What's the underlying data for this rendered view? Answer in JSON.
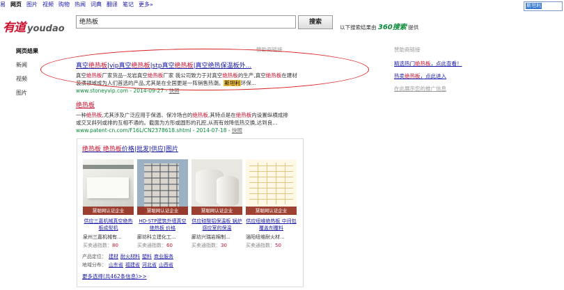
{
  "topnav": [
    "易",
    "网页",
    "图片",
    "视频",
    "购物",
    "热闻",
    "词典",
    "翻译",
    "笔记",
    "更多»"
  ],
  "topnav_active": 1,
  "top_right_input": "斯坦利",
  "logo": {
    "cn": "有道",
    "en": "youdao"
  },
  "search": {
    "value": "绝热板",
    "button": "搜索",
    "also_text": "以下搜索结果由",
    "brand": "360搜索",
    "provider": "提供"
  },
  "leftnav": [
    "网页结果",
    "新闻",
    "视频",
    "图片"
  ],
  "sponsor_label": "赞助商链接",
  "result1": {
    "title": [
      "真空",
      "绝热板",
      "|vip真空",
      "绝热板",
      "|stp真空",
      "绝热板",
      "|真空绝热保温板外..."
    ],
    "snippet1": [
      "真空",
      "绝热板",
      "厂家货品--龙岩真空",
      "绝热板",
      "厂家 我公司致力于对真空",
      "绝热板",
      "的生产,真空",
      "绝热板",
      "在建材"
    ],
    "snippet2_a": "装潢领域成为人们首选的产品,尤其是在全国更是一阵销售热潮。",
    "snippet2_hl": "斯坦利",
    "snippet2_b": "环保...",
    "url": "www.stoneyvip.com - 2014-09-27 - ",
    "snapshot": "快照"
  },
  "result2": {
    "title": "绝热板",
    "snippet1": [
      "一种",
      "绝热板",
      ",尤其涉及广泛应用于保温、保冷场合的",
      "绝热板",
      ",其特点是在",
      "绝热板",
      "内设置纵横成排"
    ],
    "snippet2": "或交叉斜列或排的互相不通的。截面为方形或圆形的孔腔,从而有效降低热交换,达到良...",
    "url": "www.patent-cn.com/F16L/CN2378618.shtml - 2014-07-18 - ",
    "snapshot": "快照"
  },
  "card": {
    "title": [
      "绝热板",
      " ",
      "绝热板",
      "价格|批发|供应|图片"
    ],
    "badge": "慧聪网认证企业",
    "index_label": "买卖通指数：",
    "products": [
      {
        "title": "供应三嘉机械真空绝热板成型机",
        "seller": "泉州三嘉机械有...",
        "index": "80"
      },
      {
        "title": "HD-STP建筑外墙真空绝热板 价格",
        "seller": "廊坊科立建化工...",
        "index": "60"
      },
      {
        "title": "供应硅酸铝保温板 锅炉感应室的保温",
        "seller": "廊坊兴瑞岩棉制...",
        "index": "30"
      },
      {
        "title": "供应纽维绝热板 中间包覆盖剂覆料",
        "seller": "淄阳纽维耐火材...",
        "index": "50"
      }
    ],
    "positioning_label": "产品定位：",
    "positioning": [
      "建材",
      "耐火材料",
      "塑料",
      "商业服务"
    ],
    "region_label": "地域分布：",
    "regions": [
      "山东省",
      "福建省",
      "河北省",
      "山西省"
    ],
    "more": "更多选择(共462条信息)>>"
  },
  "side": {
    "header": "赞助商链接",
    "links": [
      "精选热门绝热板，点此查看！",
      "热卖绝热板，点此进入"
    ],
    "ad_link": "在此展示您的推广信息"
  },
  "colors": {
    "brand_red": "#c8102e",
    "link": "#1a1aa6",
    "url_green": "#0a8a3a",
    "annotation": "#d81e1e"
  }
}
